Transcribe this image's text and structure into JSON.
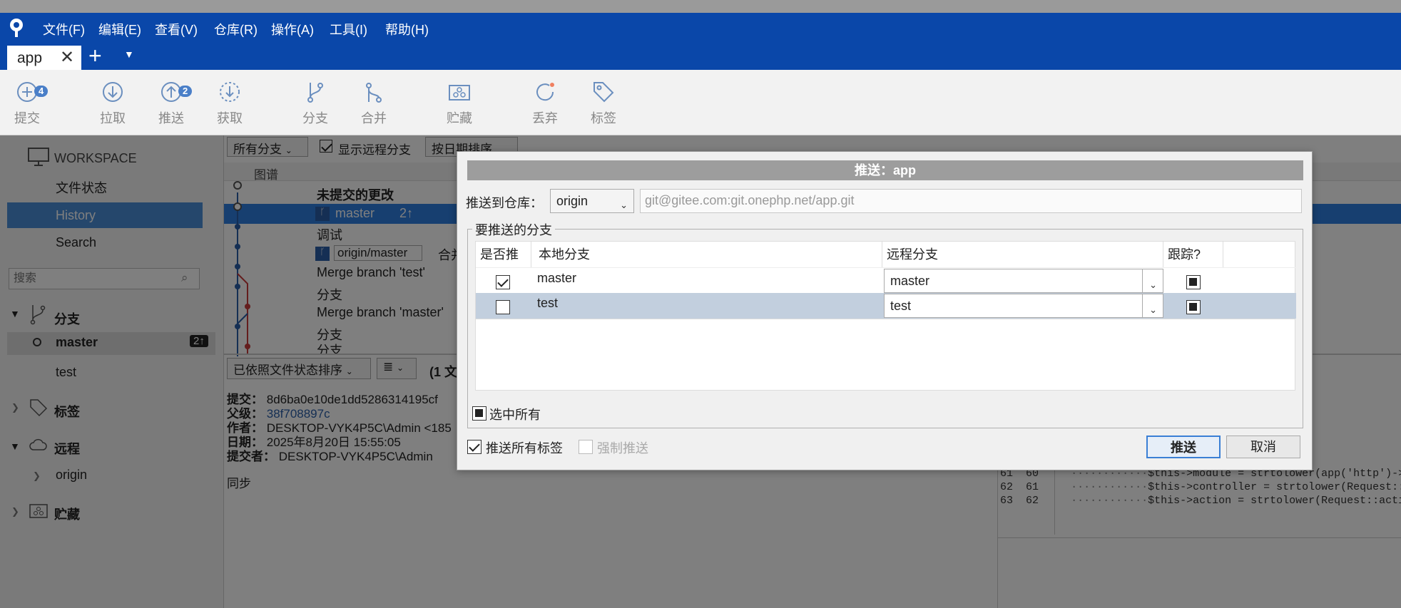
{
  "menubar": {
    "items": [
      "文件(F)",
      "编辑(E)",
      "查看(V)",
      "仓库(R)",
      "操作(A)",
      "工具(I)",
      "帮助(H)"
    ]
  },
  "tabs": {
    "active": "app"
  },
  "toolbar": {
    "items": [
      {
        "label": "提交",
        "icon": "commit-icon",
        "badge": "4"
      },
      {
        "label": "拉取",
        "icon": "pull-icon"
      },
      {
        "label": "推送",
        "icon": "push-icon",
        "badge": "2"
      },
      {
        "label": "获取",
        "icon": "fetch-icon"
      },
      {
        "label": "分支",
        "icon": "branch-icon"
      },
      {
        "label": "合并",
        "icon": "merge-icon"
      },
      {
        "label": "贮藏",
        "icon": "stash-icon"
      },
      {
        "label": "丢弃",
        "icon": "discard-icon"
      },
      {
        "label": "标签",
        "icon": "tag-icon"
      }
    ]
  },
  "sidebar": {
    "workspace": "WORKSPACE",
    "items": [
      "文件状态",
      "History",
      "Search"
    ],
    "search_placeholder": "搜索",
    "branches_header": "分支",
    "branches": [
      {
        "name": "master",
        "badge": "2↑"
      },
      {
        "name": "test"
      }
    ],
    "tags_header": "标签",
    "remotes_header": "远程",
    "remotes": [
      "origin"
    ],
    "stash_header": "贮藏"
  },
  "history": {
    "branch_filter": "所有分支",
    "show_remote": "显示远程分支",
    "sort": "按日期排序",
    "graph_header": "图谱",
    "rows": [
      {
        "text": "未提交的更改"
      },
      {
        "text": "master",
        "ahead": "2↑"
      },
      {
        "text": "调试"
      },
      {
        "text": "origin/master",
        "extra": "合并"
      },
      {
        "text": "Merge branch 'test'"
      },
      {
        "text": "分支"
      },
      {
        "text": "Merge branch 'master'"
      },
      {
        "text": "分支"
      },
      {
        "text": "分支"
      }
    ]
  },
  "files": {
    "sort": "已依照文件状态排序",
    "count": "(1 文"
  },
  "details": {
    "commit_label": "提交：",
    "commit": "8d6ba0e10de1dd5286314195cf",
    "parent_label": "父级：",
    "parent": "38f708897c",
    "author_label": "作者：",
    "author": "DESKTOP-VYK4P5C\\Admin <185",
    "date_label": "日期：",
    "date": "2025年8月20日 15:55:05",
    "committer_label": "提交者：",
    "committer": "DESKTOP-VYK4P5C\\Admin",
    "message": "同步"
  },
  "diff": {
    "lines": [
      {
        "a": "61",
        "b": "60",
        "code": "$this->module = strtolower(app('http')->g"
      },
      {
        "a": "62",
        "b": "61",
        "code": "$this->controller = strtolower(Request::c"
      },
      {
        "a": "63",
        "b": "62",
        "code": "$this->action = strtolower(Request::actio"
      }
    ]
  },
  "dialog": {
    "title": "推送：app",
    "repo_label": "推送到仓库：",
    "repo": "origin",
    "url": "git@gitee.com:git.onephp.net/app.git",
    "group_title": "要推送的分支",
    "col_push": "是否推",
    "col_local": "本地分支",
    "col_remote": "远程分支",
    "col_track": "跟踪?",
    "rows": [
      {
        "local": "master",
        "remote": "master",
        "push": true
      },
      {
        "local": "test",
        "remote": "test",
        "push": false
      }
    ],
    "select_all": "选中所有",
    "push_tags": "推送所有标签",
    "force_push": "强制推送",
    "ok": "推送",
    "cancel": "取消"
  }
}
